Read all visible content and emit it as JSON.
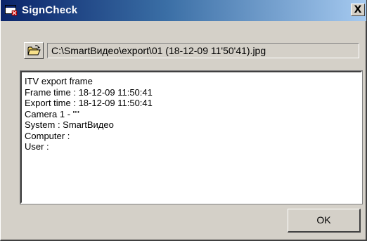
{
  "window": {
    "title": "SignCheck",
    "close_label": "X"
  },
  "file": {
    "path": "C:\\SmartВидео\\export\\01 (18-12-09 11'50'41).jpg"
  },
  "info": {
    "lines": [
      "ITV export frame",
      "Frame time : 18-12-09 11:50:41",
      "Export time : 18-12-09 11:50:41",
      "Camera 1 - \"\"",
      "System : SmartВидео",
      "Computer :",
      "User :"
    ]
  },
  "buttons": {
    "ok_label": "OK"
  },
  "icons": {
    "app": "signcheck-window-icon",
    "open": "open-folder-icon"
  },
  "colors": {
    "titlebar_start": "#0a246a",
    "titlebar_end": "#a6caf0",
    "face": "#d4d0c8"
  }
}
